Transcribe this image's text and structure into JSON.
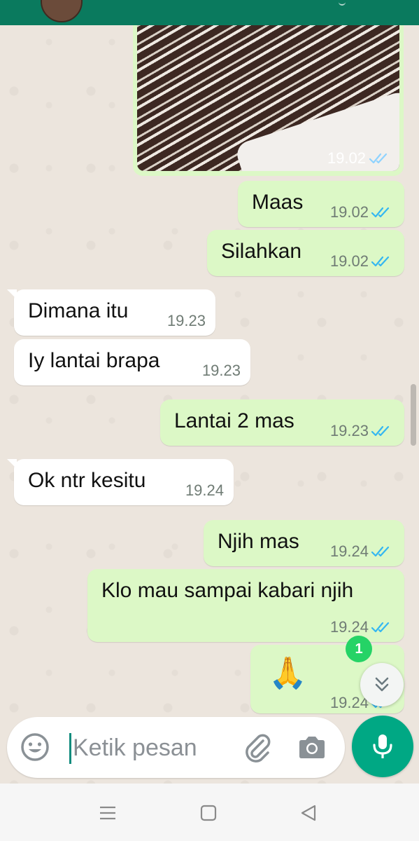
{
  "colors": {
    "header": "#0a7a5e",
    "outgoing_bubble": "#dcf8c6",
    "incoming_bubble": "#ffffff",
    "read_tick": "#34b7f1",
    "accent_green": "#00a884",
    "badge_green": "#25d366"
  },
  "image_message": {
    "time": "19.02",
    "status": "read",
    "icon": "double-check-icon"
  },
  "messages": [
    {
      "text": "Maas",
      "time": "19.02",
      "direction": "outgoing",
      "status": "read"
    },
    {
      "text": "Silahkan",
      "time": "19.02",
      "direction": "outgoing",
      "status": "read"
    },
    {
      "text": "Dimana itu",
      "time": "19.23",
      "direction": "incoming"
    },
    {
      "text": "Iy lantai brapa",
      "time": "19.23",
      "direction": "incoming"
    },
    {
      "text": "Lantai 2 mas",
      "time": "19.23",
      "direction": "outgoing",
      "status": "read"
    },
    {
      "text": "Ok ntr kesitu",
      "time": "19.24",
      "direction": "incoming"
    },
    {
      "text": "Njih mas",
      "time": "19.24",
      "direction": "outgoing",
      "status": "read"
    },
    {
      "text": "Klo mau sampai kabari njih",
      "time": "19.24",
      "direction": "outgoing",
      "status": "read"
    },
    {
      "text": "🙏",
      "time": "19.24",
      "direction": "outgoing",
      "status": "read"
    }
  ],
  "unread_count": "1",
  "composer": {
    "placeholder": "Ketik pesan",
    "icons": [
      "emoji-icon",
      "paperclip-icon",
      "camera-icon",
      "microphone-icon"
    ]
  },
  "navigation": {
    "icons": [
      "menu-icon",
      "home-icon",
      "back-icon"
    ]
  }
}
